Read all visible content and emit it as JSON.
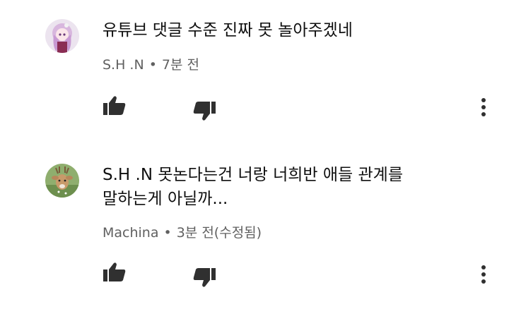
{
  "comments": [
    {
      "author": "S.H .N",
      "time": "7분 전",
      "text": "유튜브 댓글 수준 진짜 못 놀아주겠네",
      "avatar": "anime-girl-avatar"
    },
    {
      "author": "Machina",
      "time": "3분 전(수정됨)",
      "text": "S.H .N 못논다는건 너랑 너희반 애들 관계를\n말하는게 아닐까...",
      "avatar": "deer-avatar"
    }
  ],
  "meta_separator": "•",
  "colors": {
    "text": "#0f0f0f",
    "meta": "#606060",
    "icon": "#303030"
  }
}
